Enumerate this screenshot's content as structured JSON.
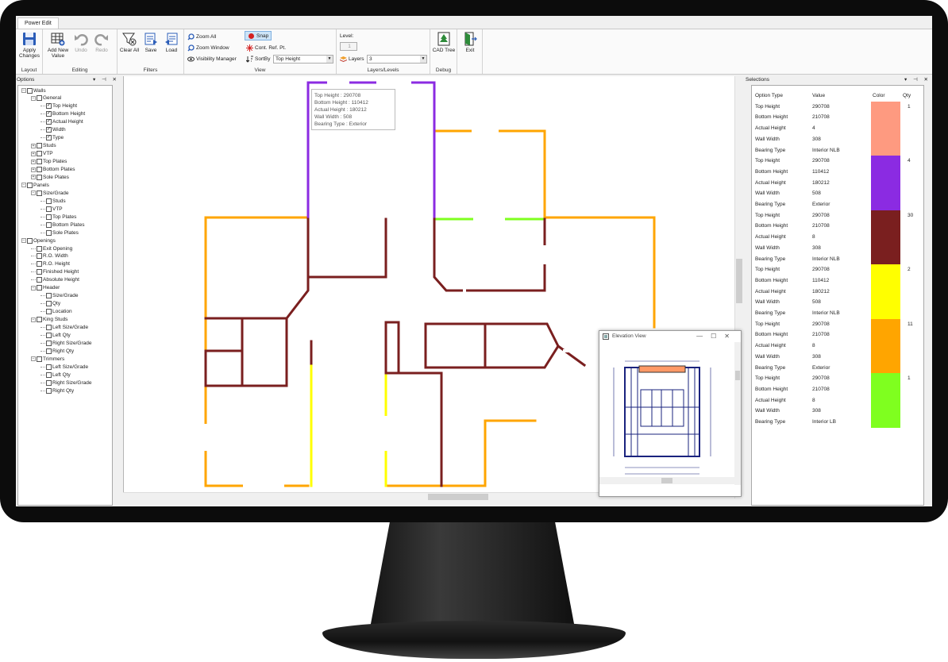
{
  "ribbon": {
    "tab": "Power Edit",
    "groups": {
      "layout": {
        "label": "Layout",
        "apply": "Apply Changes"
      },
      "editing": {
        "label": "Editing",
        "add": "Add New Value",
        "undo": "Undo",
        "redo": "Redo"
      },
      "filters": {
        "label": "Filters",
        "clear": "Clear All",
        "save": "Save",
        "load": "Load"
      },
      "view": {
        "label": "View",
        "zoom_all": "Zoom All",
        "zoom_window": "Zoom Window",
        "visibility": "Visibility Manager",
        "snap": "Snap",
        "cont_ref": "Cont. Ref. Pt.",
        "sortby": "SortBy",
        "sortby_value": "Top Height"
      },
      "layers": {
        "label": "Layers/Levels",
        "level_label": "Level:",
        "level_value": "1",
        "layers_label": "Layers",
        "layers_value": "3"
      },
      "debug": {
        "label": "Debug",
        "cad_tree": "CAD Tree"
      },
      "exit": {
        "label": "Exit"
      }
    }
  },
  "options_panel": {
    "title": "Options",
    "tree": [
      {
        "label": "Walls",
        "checked": false
      },
      {
        "label": "General",
        "checked": false
      },
      {
        "label": "Top Height",
        "checked": true
      },
      {
        "label": "Bottom Height",
        "checked": true
      },
      {
        "label": "Actual Height",
        "checked": true
      },
      {
        "label": "Width",
        "checked": true
      },
      {
        "label": "Type",
        "checked": true
      },
      {
        "label": "Studs",
        "checked": false
      },
      {
        "label": "VTP",
        "checked": false
      },
      {
        "label": "Top Plates",
        "checked": false
      },
      {
        "label": "Bottom Plates",
        "checked": false
      },
      {
        "label": "Sole Plates",
        "checked": false
      },
      {
        "label": "Panels",
        "checked": false
      },
      {
        "label": "Size/Grade",
        "checked": false
      },
      {
        "label": "Studs",
        "checked": false
      },
      {
        "label": "VTP",
        "checked": false
      },
      {
        "label": "Top Plates",
        "checked": false
      },
      {
        "label": "Bottom Plates",
        "checked": false
      },
      {
        "label": "Sole Plates",
        "checked": false
      },
      {
        "label": "Openings",
        "checked": false
      },
      {
        "label": "Exit Opening",
        "checked": false
      },
      {
        "label": "R.O. Width",
        "checked": false
      },
      {
        "label": "R.O. Height",
        "checked": false
      },
      {
        "label": "Finished Height",
        "checked": false
      },
      {
        "label": "Absolute Height",
        "checked": false
      },
      {
        "label": "Header",
        "checked": false
      },
      {
        "label": "Size/Grade",
        "checked": false
      },
      {
        "label": "Qty",
        "checked": false
      },
      {
        "label": "Location",
        "checked": false
      },
      {
        "label": "King Studs",
        "checked": false
      },
      {
        "label": "Left Size/Grade",
        "checked": false
      },
      {
        "label": "Left Qty",
        "checked": false
      },
      {
        "label": "Right Size/Grade",
        "checked": false
      },
      {
        "label": "Right Qty",
        "checked": false
      },
      {
        "label": "Trimmers",
        "checked": false
      },
      {
        "label": "Left Size/Grade",
        "checked": false
      },
      {
        "label": "Left Qty",
        "checked": false
      },
      {
        "label": "Right Size/Grade",
        "checked": false
      },
      {
        "label": "Right Qty",
        "checked": false
      }
    ]
  },
  "tooltip": {
    "line1": "Top Height : 290708",
    "line2": "Bottom Height : 110412",
    "line3": "Actual Height : 180212",
    "line4": "Wall Width : 508",
    "line5": "Bearing Type : Exterior"
  },
  "elevation_view": {
    "title": "Elevation View"
  },
  "selections_panel": {
    "title": "Selections",
    "headers": {
      "type": "Option Type",
      "value": "Value",
      "color": "Color",
      "qty": "Qty"
    },
    "groups": [
      {
        "color": "#fe9a80",
        "qty": "1",
        "rows": [
          [
            "Top Height",
            "290708"
          ],
          [
            "Bottom Height",
            "210708"
          ],
          [
            "Actual Height",
            "4"
          ],
          [
            "Wall Width",
            "308"
          ],
          [
            "Bearing Type",
            "Interior NLB"
          ]
        ]
      },
      {
        "color": "#8b2be2",
        "qty": "4",
        "rows": [
          [
            "Top Height",
            "290708"
          ],
          [
            "Bottom Height",
            "110412"
          ],
          [
            "Actual Height",
            "180212"
          ],
          [
            "Wall Width",
            "508"
          ],
          [
            "Bearing Type",
            "Exterior"
          ]
        ]
      },
      {
        "color": "#7a1f1f",
        "qty": "30",
        "rows": [
          [
            "Top Height",
            "290708"
          ],
          [
            "Bottom Height",
            "210708"
          ],
          [
            "Actual Height",
            "8"
          ],
          [
            "Wall Width",
            "308"
          ],
          [
            "Bearing Type",
            "Interior NLB"
          ]
        ]
      },
      {
        "color": "#ffff00",
        "qty": "2",
        "rows": [
          [
            "Top Height",
            "290708"
          ],
          [
            "Bottom Height",
            "110412"
          ],
          [
            "Actual Height",
            "180212"
          ],
          [
            "Wall Width",
            "508"
          ],
          [
            "Bearing Type",
            "Interior NLB"
          ]
        ]
      },
      {
        "color": "#ffa500",
        "qty": "11",
        "rows": [
          [
            "Top Height",
            "290708"
          ],
          [
            "Bottom Height",
            "210708"
          ],
          [
            "Actual Height",
            "8"
          ],
          [
            "Wall Width",
            "308"
          ],
          [
            "Bearing Type",
            "Exterior"
          ]
        ]
      },
      {
        "color": "#7fff1f",
        "qty": "1",
        "rows": [
          [
            "Top Height",
            "290708"
          ],
          [
            "Bottom Height",
            "210708"
          ],
          [
            "Actual Height",
            "8"
          ],
          [
            "Wall Width",
            "308"
          ],
          [
            "Bearing Type",
            "Interior LB"
          ]
        ]
      }
    ]
  },
  "colors": {
    "exterior_wall": "#ffa500",
    "selected_wall": "#8b2be2",
    "interior_wall": "#7a1f1f",
    "yellow_wall": "#ffff00",
    "green_wall": "#7fff1f"
  }
}
